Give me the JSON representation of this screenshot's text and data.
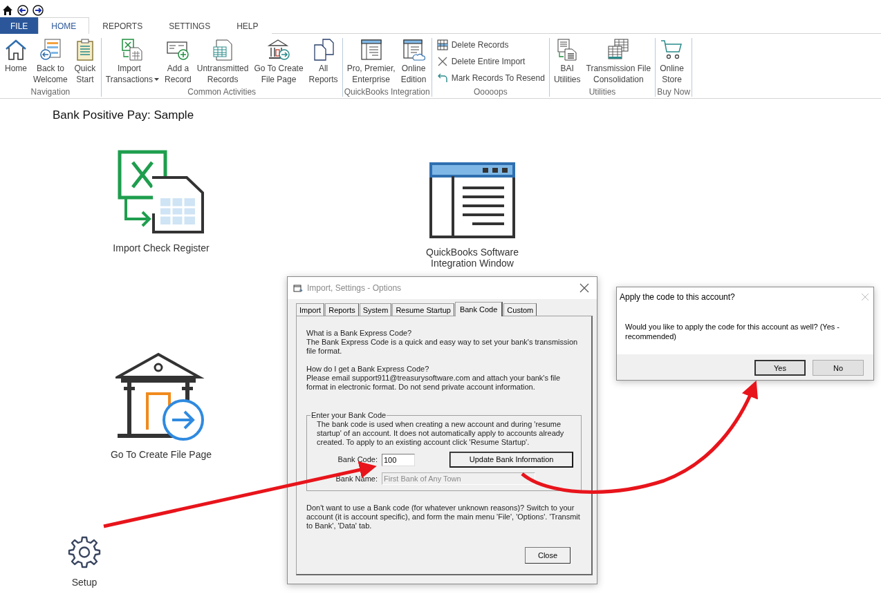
{
  "ribbon": {
    "tabs": [
      {
        "label": "FILE",
        "kind": "file",
        "selected": false
      },
      {
        "label": "HOME",
        "kind": "tab",
        "selected": true
      },
      {
        "label": "REPORTS",
        "kind": "tab",
        "selected": false
      },
      {
        "label": "SETTINGS",
        "kind": "tab",
        "selected": false
      },
      {
        "label": "HELP",
        "kind": "tab",
        "selected": false
      }
    ],
    "groups": [
      {
        "label": "Navigation",
        "items": [
          {
            "label": "Home",
            "kind": "large"
          },
          {
            "label": "Back to\nWelcome",
            "kind": "large"
          },
          {
            "label": "Quick\nStart",
            "kind": "large"
          }
        ]
      },
      {
        "label": "Common Activities",
        "items": [
          {
            "label": "Import\nTransactions",
            "kind": "large",
            "dropdown": true
          },
          {
            "label": "Add a\nRecord",
            "kind": "large"
          },
          {
            "label": "Untransmitted\nRecords",
            "kind": "large"
          },
          {
            "label": "Go To Create\nFile Page",
            "kind": "large"
          },
          {
            "label": "All\nReports",
            "kind": "large"
          }
        ]
      },
      {
        "label": "QuickBooks Integration",
        "items": [
          {
            "label": "Pro, Premier,\nEnterprise",
            "kind": "large"
          },
          {
            "label": "Online\nEdition",
            "kind": "large"
          }
        ]
      },
      {
        "label": "Ooooops",
        "items": [
          {
            "label": "Delete Records",
            "kind": "small"
          },
          {
            "label": "Delete Entire Import",
            "kind": "small"
          },
          {
            "label": "Mark Records To Resend",
            "kind": "small"
          }
        ]
      },
      {
        "label": "Utilities",
        "items": [
          {
            "label": "BAI\nUtilities",
            "kind": "large"
          },
          {
            "label": "Transmission File\nConsolidation",
            "kind": "large"
          }
        ]
      },
      {
        "label": "Buy Now",
        "items": [
          {
            "label": "Online\nStore",
            "kind": "large"
          }
        ]
      }
    ]
  },
  "page": {
    "title": "Bank Positive Pay: Sample",
    "tiles": [
      {
        "label": "Import Check Register"
      },
      {
        "label": "QuickBooks Software\nIntegration Window"
      },
      {
        "label": "Go To Create File Page"
      }
    ],
    "setup": {
      "label": "Setup"
    }
  },
  "options_dialog": {
    "title": "Import, Settings - Options",
    "tabs": [
      {
        "label": "Import",
        "selected": false
      },
      {
        "label": "Reports",
        "selected": false
      },
      {
        "label": "System",
        "selected": false
      },
      {
        "label": "Resume Startup",
        "selected": false
      },
      {
        "label": "Bank Code",
        "selected": true
      },
      {
        "label": "Custom",
        "selected": false
      }
    ],
    "sections": [
      {
        "question": "What is a Bank Express Code?",
        "answer": "The Bank Express Code is a quick and easy way to set your bank's transmission file format."
      },
      {
        "question": "How do I get a Bank Express Code?",
        "answer": "Please email support911@treasurysoftware.com and attach your bank's file format in electronic format. Do not send private account information."
      }
    ],
    "group": {
      "legend": "Enter your Bank Code",
      "description": "The bank code is used when creating a new account and during 'resume startup' of an account.  It does not automatically apply to accounts already created.  To apply to an existing account click 'Resume Startup'.",
      "bank_code": {
        "label": "Bank Code:",
        "value": "100",
        "disabled": false
      },
      "update_button": "Update Bank Information",
      "bank_name": {
        "label": "Bank Name:",
        "value": "First Bank of Any Town",
        "disabled": true
      }
    },
    "note": "Don't want to use a Bank code (for whatever unknown reasons)?  Switch to your account (it is account specific), and form the main menu 'File', 'Options'. 'Transmit to Bank', 'Data' tab.",
    "close_button": "Close"
  },
  "confirm_dialog": {
    "title": "Apply the code to this account?",
    "message": "Would you like to apply the code for this account as well? (Yes - recommended)",
    "buttons": [
      {
        "label": "Yes",
        "default": true
      },
      {
        "label": "No",
        "default": false
      }
    ]
  }
}
